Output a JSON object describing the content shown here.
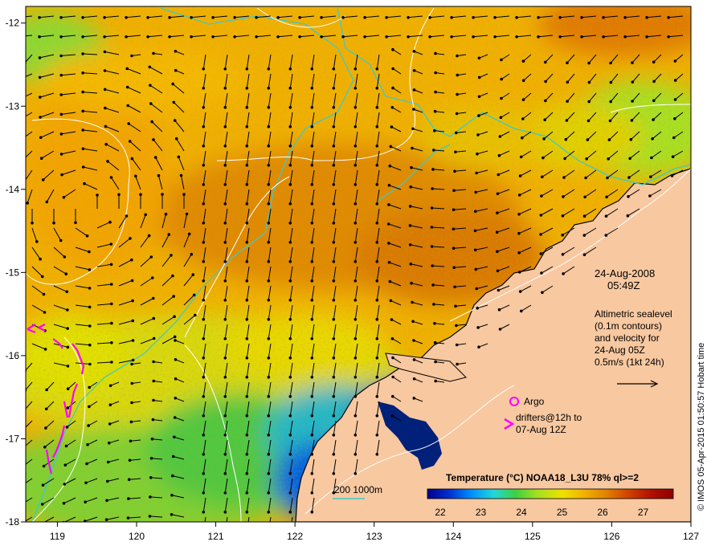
{
  "map": {
    "lon_ticks": [
      119,
      120,
      121,
      122,
      123,
      124,
      125,
      126,
      127
    ],
    "lat_ticks": [
      -12,
      -13,
      -14,
      -15,
      -16,
      -17,
      -18
    ],
    "date": "24-Aug-2008",
    "time": "05:49Z",
    "altimetry_lines": [
      "Altimetric sealevel",
      "(0.1m contours)",
      "and velocity for",
      "24-Aug 05Z",
      "0.5m/s (1kt 24h)"
    ],
    "argo_label": "Argo",
    "drifters_lines": [
      "drifters@12h to",
      "07-Aug 12Z"
    ],
    "bathymetry_label": "200  1000m",
    "colorbar": {
      "title": "Temperature (°C) NOAA18_L3U 78% ql>=2",
      "ticks": [
        "22",
        "23",
        "24",
        "25",
        "26",
        "27"
      ],
      "colors": [
        "#00008b",
        "#0030d0",
        "#0090ff",
        "#20d8d8",
        "#40d040",
        "#a8e020",
        "#f0e000",
        "#f0b000",
        "#e08000",
        "#d04000",
        "#b01000",
        "#900000"
      ]
    },
    "credit": "© IMOS 05-Apr-2015 01:50:57 Hobart time",
    "colors": {
      "land": "#f8c8a0",
      "isobath": "#40c8c8",
      "drifter": "#ff00ff"
    }
  }
}
